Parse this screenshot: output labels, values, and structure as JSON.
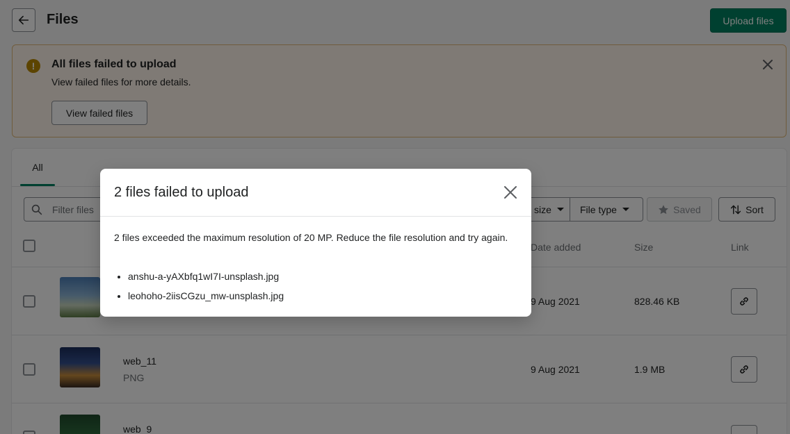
{
  "header": {
    "title": "Files",
    "upload_label": "Upload files"
  },
  "banner": {
    "title": "All files failed to upload",
    "text": "View failed files for more details.",
    "button_label": "View failed files"
  },
  "tabs": [
    {
      "label": "All"
    }
  ],
  "toolbar": {
    "search_placeholder": "Filter files",
    "size_label": "size",
    "file_type_label": "File type",
    "saved_label": "Saved",
    "sort_label": "Sort"
  },
  "table": {
    "columns": {
      "date_added": "Date added",
      "size": "Size",
      "link": "Link"
    },
    "rows": [
      {
        "name": "",
        "type": "",
        "date": "9 Aug 2021",
        "size": "828.46 KB"
      },
      {
        "name": "web_11",
        "type": "PNG",
        "date": "9 Aug 2021",
        "size": "1.9 MB"
      },
      {
        "name": "web_9",
        "type": "",
        "date": "",
        "size": ""
      }
    ]
  },
  "modal": {
    "title": "2 files failed to upload",
    "message": "2 files exceeded the maximum resolution of 20 MP. Reduce the file resolution and try again.",
    "files": [
      "anshu-a-yAXbfq1wI7I-unsplash.jpg",
      "leohoho-2iisCGzu_mw-unsplash.jpg"
    ]
  },
  "colors": {
    "primary": "#008060",
    "warning": "#b98900",
    "banner_bg": "#fff5ea"
  }
}
